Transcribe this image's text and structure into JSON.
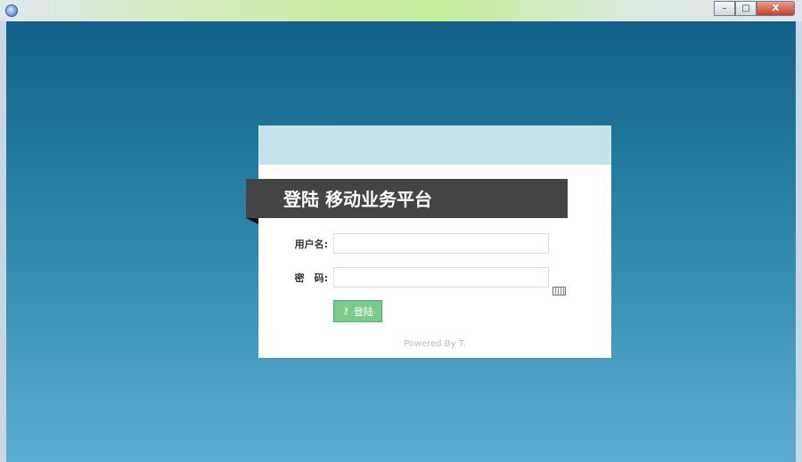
{
  "window": {
    "minimize": "–",
    "maximize": "□",
    "close": "X"
  },
  "login": {
    "title": "登陆 移动业务平台",
    "username_label": "用户名:",
    "username_value": "",
    "password_label": "密　码:",
    "password_value": "",
    "submit_label": "登陆",
    "footer": "Powered By T."
  }
}
